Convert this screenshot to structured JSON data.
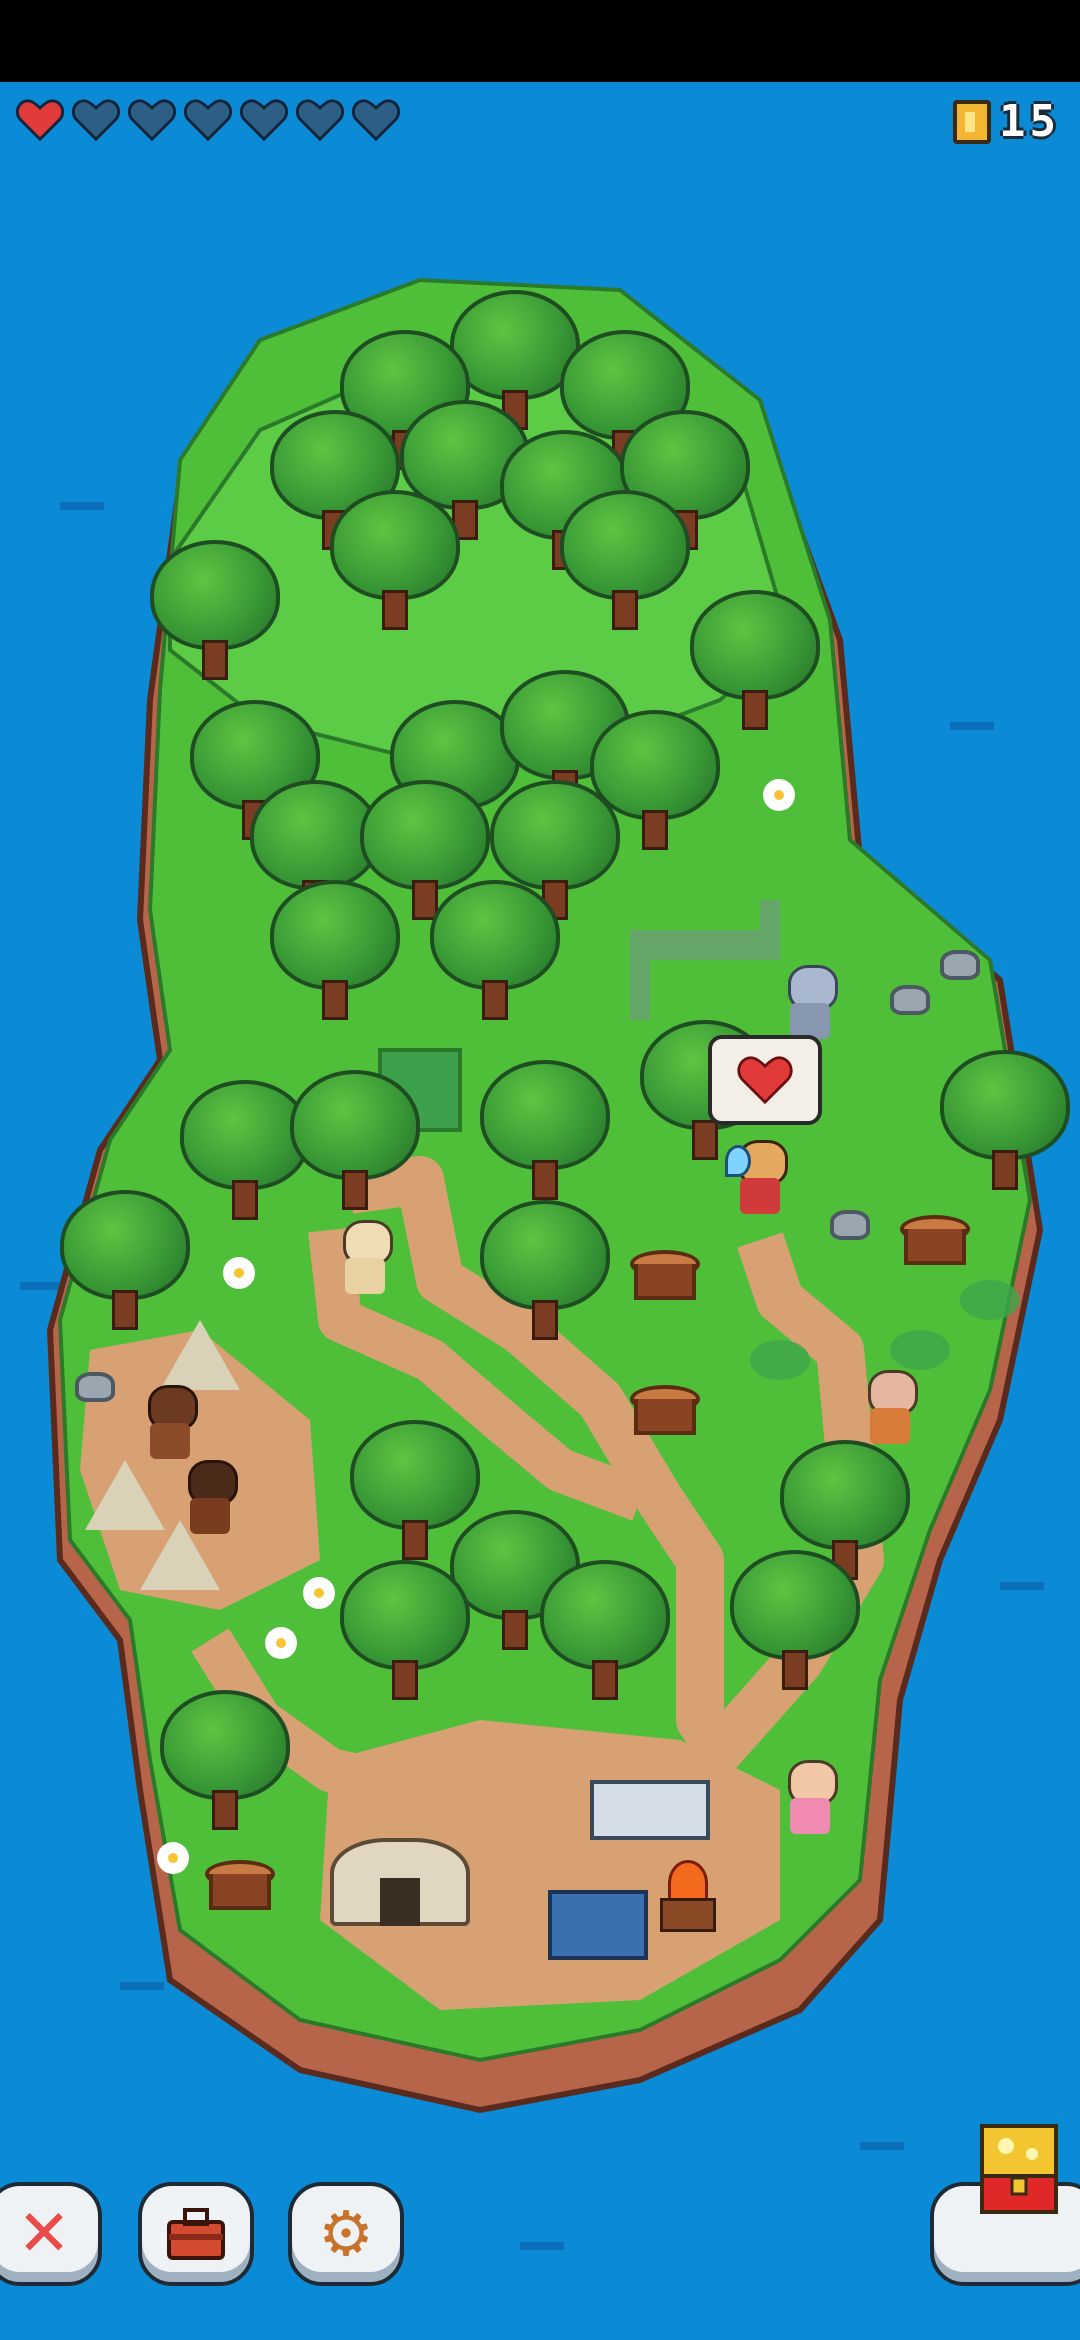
{
  "hud": {
    "hearts": {
      "filled": 1,
      "total": 7,
      "filled_color": "#e03a3a",
      "empty_color": "#2c5e86"
    },
    "coins": {
      "icon": "coin-icon",
      "count": "15"
    }
  },
  "speech_bubble": {
    "icon": "heart-icon"
  },
  "toolbar": {
    "buttons": [
      {
        "name": "close-button",
        "icon": "close-x-icon"
      },
      {
        "name": "inventory-button",
        "icon": "toolbox-icon"
      },
      {
        "name": "settings-button",
        "icon": "gear-icon"
      },
      {
        "name": "treasure-chest-button",
        "icon": "treasure-chest-icon"
      }
    ]
  },
  "colors": {
    "ocean": "#0b8ad6",
    "grass": "#4fbf3a",
    "path": "#d7a173",
    "cliff": "#b7654a"
  }
}
